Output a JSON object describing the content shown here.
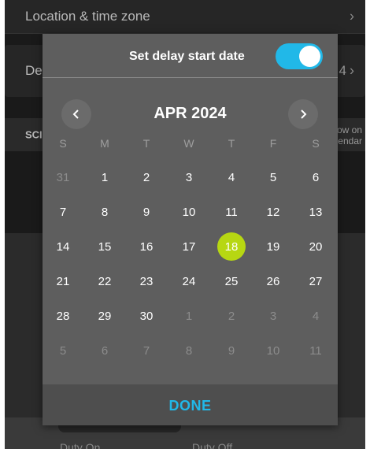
{
  "background": {
    "location_label": "Location & time zone",
    "delay_label_partial": "De",
    "delay_value_partial": "4",
    "small_label_partial": "SCI",
    "small_side_line1": "ow on",
    "small_side_line2": "endar",
    "duty_on_label": "Duty On",
    "duty_off_label": "Duty Off"
  },
  "modal": {
    "title": "Set delay start date",
    "toggle_on": true,
    "month_label": "APR 2024",
    "weekdays": [
      "S",
      "M",
      "T",
      "W",
      "T",
      "F",
      "S"
    ],
    "weeks": [
      [
        {
          "d": "31",
          "muted": true
        },
        {
          "d": "1"
        },
        {
          "d": "2"
        },
        {
          "d": "3"
        },
        {
          "d": "4"
        },
        {
          "d": "5"
        },
        {
          "d": "6"
        }
      ],
      [
        {
          "d": "7"
        },
        {
          "d": "8"
        },
        {
          "d": "9"
        },
        {
          "d": "10"
        },
        {
          "d": "11"
        },
        {
          "d": "12"
        },
        {
          "d": "13"
        }
      ],
      [
        {
          "d": "14"
        },
        {
          "d": "15"
        },
        {
          "d": "16"
        },
        {
          "d": "17"
        },
        {
          "d": "18",
          "selected": true
        },
        {
          "d": "19"
        },
        {
          "d": "20"
        }
      ],
      [
        {
          "d": "21"
        },
        {
          "d": "22"
        },
        {
          "d": "23"
        },
        {
          "d": "24"
        },
        {
          "d": "25"
        },
        {
          "d": "26"
        },
        {
          "d": "27"
        }
      ],
      [
        {
          "d": "28"
        },
        {
          "d": "29"
        },
        {
          "d": "30"
        },
        {
          "d": "1",
          "muted": true
        },
        {
          "d": "2",
          "muted": true
        },
        {
          "d": "3",
          "muted": true
        },
        {
          "d": "4",
          "muted": true
        }
      ],
      [
        {
          "d": "5",
          "muted": true
        },
        {
          "d": "6",
          "muted": true
        },
        {
          "d": "7",
          "muted": true
        },
        {
          "d": "8",
          "muted": true
        },
        {
          "d": "9",
          "muted": true
        },
        {
          "d": "10",
          "muted": true
        },
        {
          "d": "11",
          "muted": true
        }
      ]
    ],
    "done_label": "DONE"
  },
  "colors": {
    "accent": "#21b8e8",
    "selected_day": "#b7d712"
  },
  "icons": {
    "prev": "chevron-left-icon",
    "next": "chevron-right-icon"
  }
}
